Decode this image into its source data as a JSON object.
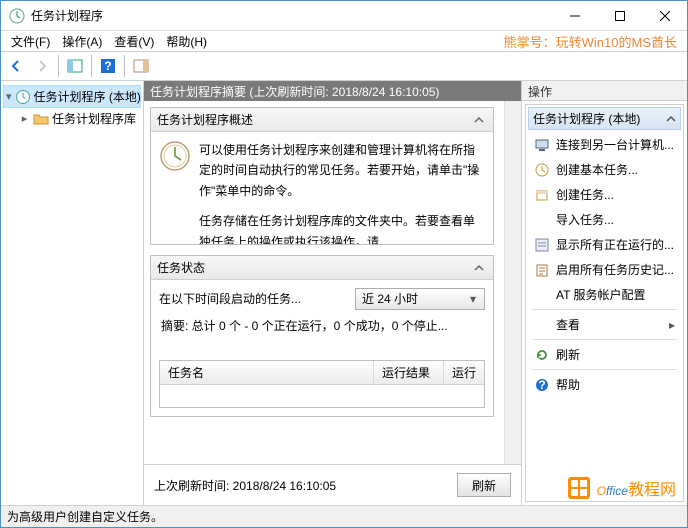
{
  "window": {
    "title": "任务计划程序"
  },
  "menu": {
    "file": "文件(F)",
    "action": "操作(A)",
    "view": "查看(V)",
    "help": "帮助(H)"
  },
  "watermark": "熊掌号：玩转Win10的MS酋长",
  "tree": {
    "root": "任务计划程序 (本地)",
    "lib": "任务计划程序库"
  },
  "center": {
    "header": "任务计划程序摘要 (上次刷新时间: 2018/8/24 16:10:05)",
    "overview_title": "任务计划程序概述",
    "overview_p1": "可以使用任务计划程序来创建和管理计算机将在所指定的时间自动执行的常见任务。若要开始，请单击\"操作\"菜单中的命令。",
    "overview_p2": "任务存储在任务计划程序库的文件夹中。若要查看单独任务上的操作或执行该操作，请",
    "status_title": "任务状态",
    "status_label": "在以下时间段启动的任务...",
    "status_combo": "近 24 小时",
    "status_summary": "摘要: 总计 0 个 - 0 个正在运行，0 个成功，0 个停止...",
    "col_name": "任务名",
    "col_result": "运行结果",
    "col_run": "运行",
    "footer_text": "上次刷新时间: 2018/8/24 16:10:05",
    "refresh_btn": "刷新"
  },
  "actions": {
    "pane_title": "操作",
    "group_title": "任务计划程序 (本地)",
    "items": [
      "连接到另一台计算机...",
      "创建基本任务...",
      "创建任务...",
      "导入任务...",
      "显示所有正在运行的...",
      "启用所有任务历史记...",
      "AT 服务帐户配置",
      "查看",
      "刷新",
      "帮助"
    ]
  },
  "statusbar": "为高级用户创建自定义任务。",
  "logo": {
    "text": "Office",
    "suffix": "教程网"
  }
}
